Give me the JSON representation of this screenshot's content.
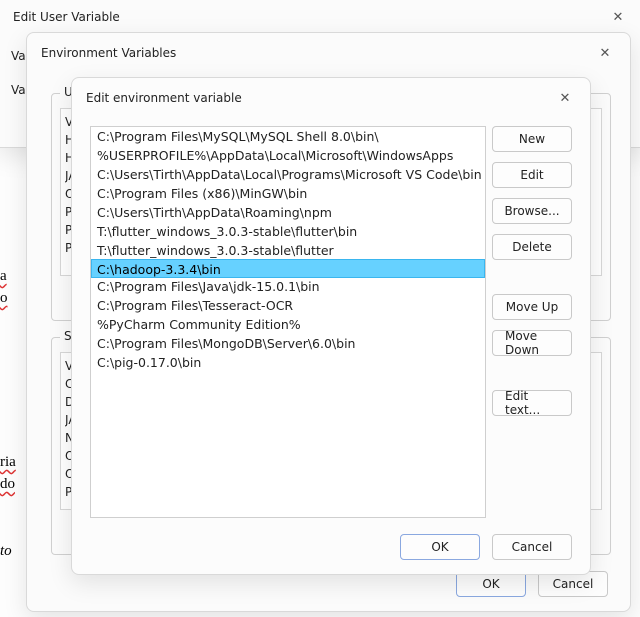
{
  "dlg1": {
    "title": "Edit User Variable",
    "label_name": "Var",
    "label_value": "Var"
  },
  "dlg2": {
    "title": "Environment Variables",
    "group_user_legend": "User",
    "group_sys_legend": "Syst",
    "ok": "OK",
    "cancel": "Cancel",
    "user_var_names": [
      "Va",
      "HA",
      "HA",
      "JA",
      "On",
      "Pa",
      "PU",
      "Pv"
    ],
    "sys_var_names": [
      "Va",
      "Co",
      "Dr",
      "JA",
      "NU",
      "On",
      "OS",
      "Pa"
    ]
  },
  "dlg3": {
    "title": "Edit environment variable",
    "entries": [
      "C:\\Program Files\\MySQL\\MySQL Shell 8.0\\bin\\",
      "%USERPROFILE%\\AppData\\Local\\Microsoft\\WindowsApps",
      "C:\\Users\\Tirth\\AppData\\Local\\Programs\\Microsoft VS Code\\bin",
      "C:\\Program Files (x86)\\MinGW\\bin",
      "C:\\Users\\Tirth\\AppData\\Roaming\\npm",
      "T:\\flutter_windows_3.0.3-stable\\flutter\\bin",
      "T:\\flutter_windows_3.0.3-stable\\flutter",
      "C:\\hadoop-3.3.4\\bin",
      "C:\\Program Files\\Java\\jdk-15.0.1\\bin",
      "C:\\Program Files\\Tesseract-OCR",
      "%PyCharm Community Edition%",
      "C:\\Program Files\\MongoDB\\Server\\6.0\\bin",
      "C:\\pig-0.17.0\\bin"
    ],
    "selected_index": 7,
    "buttons": {
      "new": "New",
      "edit": "Edit",
      "browse": "Browse...",
      "delete": "Delete",
      "move_up": "Move Up",
      "move_down": "Move Down",
      "edit_text": "Edit text...",
      "ok": "OK",
      "cancel": "Cancel"
    }
  },
  "bg_words": {
    "w1": "a",
    "w2": "o",
    "w3": "ria",
    "w4": "do",
    "w5": "to"
  }
}
